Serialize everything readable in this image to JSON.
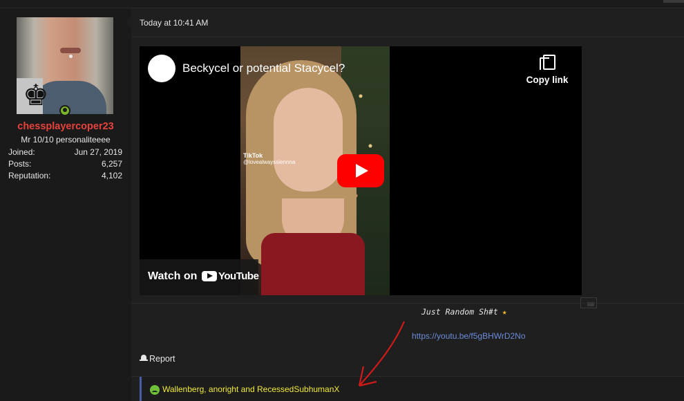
{
  "user": {
    "username": "chessplayercoper23",
    "title": "Mr 10/10 personaliteeee",
    "stats": [
      {
        "label": "Joined:",
        "value": "Jun 27, 2019"
      },
      {
        "label": "Posts:",
        "value": "6,257"
      },
      {
        "label": "Reputation:",
        "value": "4,102"
      }
    ],
    "online": true
  },
  "post": {
    "timestamp": "Today at 10:41 AM",
    "embed": {
      "video_title": "Beckycel or potential Stacycel?",
      "copy_link_label": "Copy link",
      "watch_on_label": "Watch on",
      "youtube_label": "YouTube",
      "tiktok_label": "TikTok",
      "tiktok_handle": "@lovealwayssiennna"
    },
    "signature": {
      "text": "Just Random Sh#t",
      "link": "https://youtu.be/f5gBHWrD2No"
    },
    "report_label": "Report",
    "reactions_text": "Wallenberg, anoright and RecessedSubhumanX"
  },
  "colors": {
    "username": "#e8423c",
    "link": "#6c8bd8",
    "reactions_text": "#f2ea3c",
    "youtube_red": "#ff0000",
    "online": "#7ab52a"
  }
}
